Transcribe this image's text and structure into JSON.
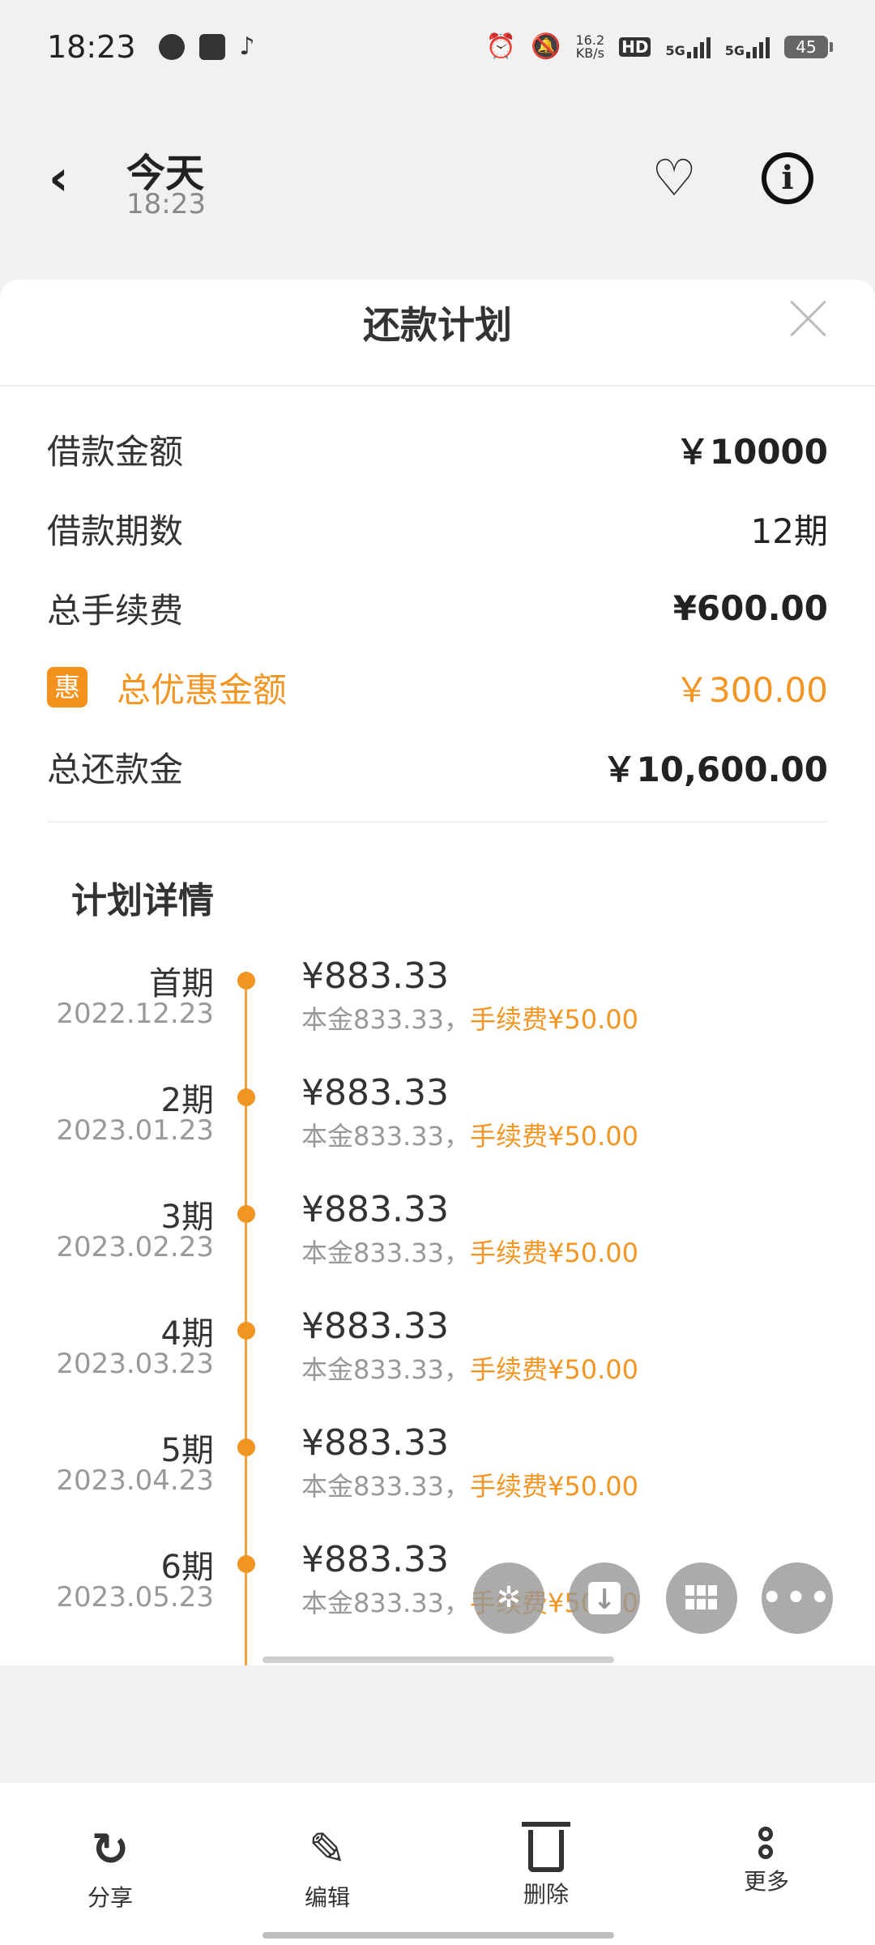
{
  "status_bar": {
    "time": "18:23",
    "net_speed_value": "16.2",
    "net_speed_unit": "KB/s",
    "hd_label": "HD",
    "signal_1": "5G",
    "signal_2": "5G",
    "battery": "45",
    "icons": [
      "alarm-icon",
      "mute-icon",
      "wifi-hd-icon",
      "signal-icon",
      "battery-icon"
    ]
  },
  "header": {
    "back_icon": "‹",
    "title": "今天",
    "subtitle": "18:23",
    "favorite_icon": "♡",
    "info_icon": "i"
  },
  "sheet": {
    "title": "还款计划",
    "summary": {
      "loan_amount_label": "借款金额",
      "loan_amount_value": "￥10000",
      "periods_label": "借款期数",
      "periods_value": "12期",
      "total_fee_label": "总手续费",
      "total_fee_value": "¥600.00",
      "discount_badge": "惠",
      "discount_label": "总优惠金额",
      "discount_value": "￥300.00",
      "total_repay_label": "总还款金",
      "total_repay_value": "￥10,600.00"
    },
    "detail_title": "计划详情",
    "plan": [
      {
        "period": "首期",
        "date": "2022.12.23",
        "amount": "¥883.33",
        "principal": "本金833.33，",
        "fee": "手续费¥50.00"
      },
      {
        "period": "2期",
        "date": "2023.01.23",
        "amount": "¥883.33",
        "principal": "本金833.33，",
        "fee": "手续费¥50.00"
      },
      {
        "period": "3期",
        "date": "2023.02.23",
        "amount": "¥883.33",
        "principal": "本金833.33，",
        "fee": "手续费¥50.00"
      },
      {
        "period": "4期",
        "date": "2023.03.23",
        "amount": "¥883.33",
        "principal": "本金833.33，",
        "fee": "手续费¥50.00"
      },
      {
        "period": "5期",
        "date": "2023.04.23",
        "amount": "¥883.33",
        "principal": "本金833.33，",
        "fee": "手续费¥50.00"
      },
      {
        "period": "6期",
        "date": "2023.05.23",
        "amount": "¥883.33",
        "principal": "本金833.33，",
        "fee": "手续费¥50.00"
      }
    ]
  },
  "fabs": {
    "f1_icon": "✲",
    "f4_icon": "•••"
  },
  "bottom_bar": {
    "share_label": "分享",
    "share_icon": "↻",
    "edit_label": "编辑",
    "edit_icon": "✎",
    "delete_label": "删除",
    "more_label": "更多"
  }
}
